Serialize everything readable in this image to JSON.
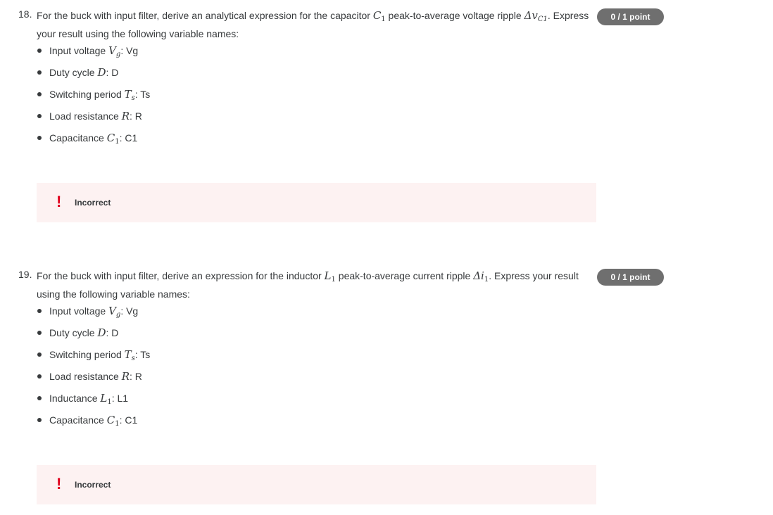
{
  "questions": [
    {
      "number": "18.",
      "text_before": "For the buck with input filter, derive an analytical expression for the capacitor ",
      "math_symbol": "C",
      "math_symbol_sub": "1",
      "text_middle": " peak-to-average voltage ripple ",
      "ripple_symbol": "Δv",
      "ripple_sub": "C1",
      "text_after": ". Express your result using the following variable names:",
      "points": "0 / 1 point",
      "variables": [
        {
          "label": "Input voltage ",
          "symbol": "V",
          "sub": "g",
          "name": ": Vg"
        },
        {
          "label": "Duty cycle ",
          "symbol": "D",
          "sub": "",
          "name": ": D"
        },
        {
          "label": "Switching period ",
          "symbol": "T",
          "sub": "s",
          "name": ": Ts"
        },
        {
          "label": "Load resistance ",
          "symbol": "R",
          "sub": "",
          "name": ": R"
        },
        {
          "label": "Capacitance ",
          "symbol": "C",
          "sub": "1",
          "name": ": C1"
        }
      ],
      "feedback_icon": "!",
      "feedback_status": "Incorrect"
    },
    {
      "number": "19.",
      "text_before": "For the buck with input filter, derive an expression for the inductor ",
      "math_symbol": "L",
      "math_symbol_sub": "1",
      "text_middle": " peak-to-average current ripple ",
      "ripple_symbol": "Δi",
      "ripple_sub": "1",
      "text_after": ". Express your result using the following variable names:",
      "points": "0 / 1 point",
      "variables": [
        {
          "label": "Input voltage ",
          "symbol": "V",
          "sub": "g",
          "name": ": Vg"
        },
        {
          "label": "Duty cycle ",
          "symbol": "D",
          "sub": "",
          "name": ": D"
        },
        {
          "label": "Switching period ",
          "symbol": "T",
          "sub": "s",
          "name": ": Ts"
        },
        {
          "label": "Load resistance ",
          "symbol": "R",
          "sub": "",
          "name": ": R"
        },
        {
          "label": "Inductance ",
          "symbol": "L",
          "sub": "1",
          "name": ": L1"
        },
        {
          "label": "Capacitance ",
          "symbol": "C",
          "sub": "1",
          "name": ": C1"
        }
      ],
      "feedback_icon": "!",
      "feedback_status": "Incorrect"
    }
  ],
  "colors": {
    "badge_bg": "#6f6f6f",
    "feedback_bg": "#fdf2f2",
    "error_red": "#e0001b",
    "text": "#373a3c"
  }
}
